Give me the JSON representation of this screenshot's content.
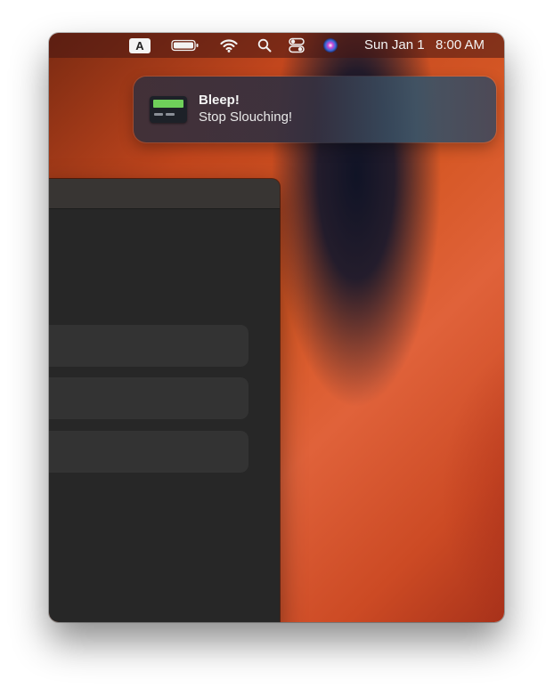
{
  "menubar": {
    "input_source": "A",
    "status_icons": [
      "battery-icon",
      "wifi-icon",
      "search-icon",
      "control-center-icon",
      "siri-icon"
    ],
    "date": "Sun Jan 1",
    "time": "8:00 AM"
  },
  "notification": {
    "app_icon": "pager-icon",
    "title": "Bleep!",
    "body": "Stop Slouching!"
  },
  "window": {
    "rows": [
      "",
      "",
      ""
    ]
  },
  "colors": {
    "wallpaper_orange": "#d65826",
    "wallpaper_dark": "#101a33",
    "window_bg": "#272727",
    "row_bg": "#333333",
    "pager_screen": "#6fd05a"
  }
}
